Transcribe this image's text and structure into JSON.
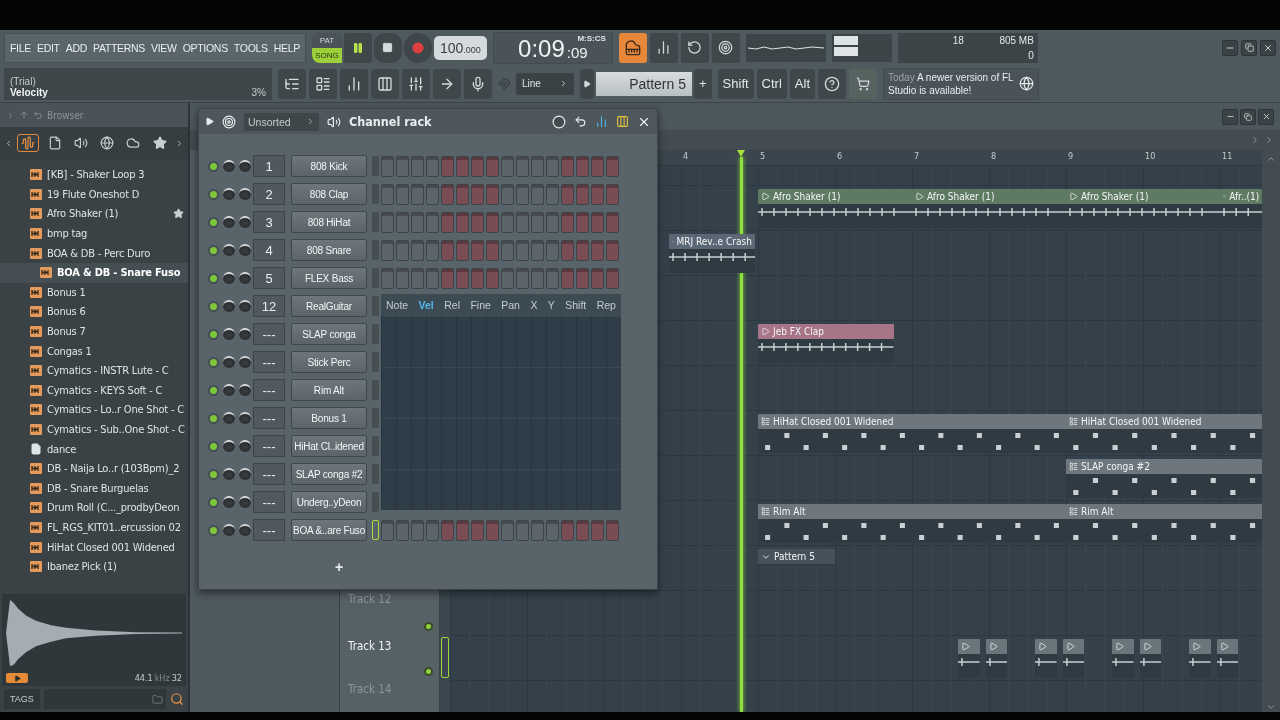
{
  "menu": [
    "FILE",
    "EDIT",
    "ADD",
    "PATTERNS",
    "VIEW",
    "OPTIONS",
    "TOOLS",
    "HELP"
  ],
  "transport": {
    "modes": [
      {
        "label": "PAT",
        "selected": false
      },
      {
        "label": "SONG",
        "selected": true
      }
    ],
    "tempo": "100",
    "tempo_fraction": ".000",
    "time": "0:09",
    "time_cs": ":09",
    "time_unit": "M:S:CS"
  },
  "hint": {
    "line1": "(Trial)",
    "line2": "Velocity",
    "value": "3%"
  },
  "snap": "Line",
  "pattern": "Pattern 5",
  "pattern_add": "+",
  "modifier_keys": [
    "Shift",
    "Ctrl",
    "Alt"
  ],
  "cpu": {
    "cpu_value": "18",
    "memory": "805 MB",
    "polyphony": "0"
  },
  "news": {
    "when": "Today",
    "text": "A newer version of FL Studio is available!"
  },
  "browser": {
    "title": "Browser",
    "items": [
      {
        "label": "[KB] - Shaker Loop 3",
        "kind": "audio",
        "selected": false,
        "starred": false
      },
      {
        "label": "19 Flute Oneshot D",
        "kind": "audio",
        "selected": false,
        "starred": false
      },
      {
        "label": "Afro Shaker (1)",
        "kind": "audio",
        "selected": false,
        "starred": true
      },
      {
        "label": "bmp tag",
        "kind": "audio",
        "selected": false,
        "starred": false
      },
      {
        "label": "BOA & DB - Perc Duro",
        "kind": "audio",
        "selected": false,
        "starred": false
      },
      {
        "label": "BOA & DB - Snare Fuso",
        "kind": "audio",
        "selected": true,
        "starred": false
      },
      {
        "label": "Bonus 1",
        "kind": "audio",
        "selected": false,
        "starred": false
      },
      {
        "label": "Bonus 6",
        "kind": "audio",
        "selected": false,
        "starred": false
      },
      {
        "label": "Bonus 7",
        "kind": "audio",
        "selected": false,
        "starred": false
      },
      {
        "label": "Congas 1",
        "kind": "audio",
        "selected": false,
        "starred": false
      },
      {
        "label": "Cymatics - INSTR Lute - C",
        "kind": "audio",
        "selected": false,
        "starred": false
      },
      {
        "label": "Cymatics - KEYS Soft - C",
        "kind": "audio",
        "selected": false,
        "starred": false
      },
      {
        "label": "Cymatics - Lo..r One Shot - C",
        "kind": "audio",
        "selected": false,
        "starred": false
      },
      {
        "label": "Cymatics - Sub..One Shot - C",
        "kind": "audio",
        "selected": false,
        "starred": false
      },
      {
        "label": "dance",
        "kind": "file",
        "selected": false,
        "starred": false
      },
      {
        "label": "DB - Naija Lo..r (103Bpm)_2",
        "kind": "audio",
        "selected": false,
        "starred": false
      },
      {
        "label": "DB - Snare Burguelas",
        "kind": "audio",
        "selected": false,
        "starred": false
      },
      {
        "label": "Drum Roll (C..._prodbyDeon",
        "kind": "audio",
        "selected": false,
        "starred": false
      },
      {
        "label": "FL_RGS_KIT01..ercussion 02",
        "kind": "audio",
        "selected": false,
        "starred": false
      },
      {
        "label": "HiHat Closed 001 Widened",
        "kind": "audio",
        "selected": false,
        "starred": false
      },
      {
        "label": "Ibanez Pick (1)",
        "kind": "audio",
        "selected": false,
        "starred": false
      }
    ],
    "sample_info": {
      "rate": "44.1",
      "unit": "kHz",
      "bits": "32"
    },
    "tags_button": "TAGS"
  },
  "channel_rack": {
    "title": "Channel rack",
    "filter": "Unsorted",
    "add": "+",
    "channels": [
      {
        "track": "1",
        "name": "808 Kick",
        "enabled": true,
        "selected": false
      },
      {
        "track": "2",
        "name": "808 Clap",
        "enabled": true,
        "selected": false
      },
      {
        "track": "3",
        "name": "808 HiHat",
        "enabled": true,
        "selected": false
      },
      {
        "track": "4",
        "name": "808 Snare",
        "enabled": true,
        "selected": false
      },
      {
        "track": "5",
        "name": "FLEX Bass",
        "enabled": true,
        "selected": false
      },
      {
        "track": "12",
        "name": "RealGuitar",
        "enabled": true,
        "selected": false
      },
      {
        "track": "---",
        "name": "SLAP conga",
        "enabled": true,
        "selected": false
      },
      {
        "track": "---",
        "name": "Stick Perc",
        "enabled": true,
        "selected": false
      },
      {
        "track": "---",
        "name": "Rim  Alt",
        "enabled": true,
        "selected": false
      },
      {
        "track": "---",
        "name": "Bonus 1",
        "enabled": true,
        "selected": false
      },
      {
        "track": "---",
        "name": "HiHat Cl..idened",
        "enabled": true,
        "selected": false
      },
      {
        "track": "---",
        "name": "SLAP conga #2",
        "enabled": true,
        "selected": false
      },
      {
        "track": "---",
        "name": "Underg..yDeon",
        "enabled": true,
        "selected": false
      },
      {
        "track": "---",
        "name": "BOA &..are Fuso",
        "enabled": true,
        "selected": true
      }
    ],
    "graph_editor": {
      "tabs": [
        {
          "label": "Note",
          "selected": false
        },
        {
          "label": "Vel",
          "selected": true
        },
        {
          "label": "Rel",
          "selected": false
        },
        {
          "label": "Fine",
          "selected": false
        },
        {
          "label": "Pan",
          "selected": false
        },
        {
          "label": "X",
          "selected": false
        },
        {
          "label": "Y",
          "selected": false
        },
        {
          "label": "Shift",
          "selected": false
        },
        {
          "label": "Rep",
          "selected": false
        }
      ]
    }
  },
  "playlist": {
    "ruler": [
      "4",
      "5",
      "6",
      "7",
      "8",
      "9",
      "10",
      "11"
    ],
    "tracks": [
      {
        "kind": "lane",
        "clips": [
          {
            "label": "Afro Shaker (1)",
            "kind": "audio",
            "color": "#5f7a63"
          },
          {
            "label": "Afro Shaker (1)",
            "kind": "audio",
            "color": "#5f7a63"
          },
          {
            "label": "Afro Shaker (1)",
            "kind": "audio",
            "color": "#5f7a63"
          },
          {
            "label": "Afr..(1)",
            "kind": "audio",
            "color": "#5f7a63"
          }
        ]
      },
      {
        "kind": "lane",
        "clips": [
          {
            "label": "MRJ Rev..e Crash",
            "kind": "audio",
            "color": "#5c6775"
          }
        ]
      },
      {
        "kind": "lane"
      },
      {
        "kind": "lane",
        "clips": [
          {
            "label": "Jeb FX Clap",
            "kind": "audio",
            "color": "#a77488"
          }
        ]
      },
      {
        "kind": "lane"
      },
      {
        "kind": "lane",
        "clips": [
          {
            "label": "HiHat Closed 001 Widened",
            "kind": "pattern",
            "color": "#6d777d"
          },
          {
            "label": "HiHat Closed 001 Widened",
            "kind": "pattern",
            "color": "#6d777d"
          }
        ]
      },
      {
        "kind": "lane",
        "clips": [
          {
            "label": "SLAP conga #2",
            "kind": "pattern",
            "color": "#6d777d"
          }
        ]
      },
      {
        "kind": "lane",
        "clips": [
          {
            "label": "Rim  Alt",
            "kind": "pattern",
            "color": "#6d777d"
          },
          {
            "label": "Rim  Alt",
            "kind": "pattern",
            "color": "#6d777d"
          }
        ]
      },
      {
        "kind": "lane",
        "clips": [
          {
            "label": "Pattern 5",
            "kind": "folded",
            "color": "#46525b"
          }
        ]
      },
      {
        "kind": "lane",
        "name": "Track 12",
        "selected": false
      },
      {
        "kind": "lane",
        "name": "Track 13",
        "selected": true,
        "clips": [
          {
            "kind": "audio",
            "color": "#6a757c"
          },
          {
            "kind": "audio",
            "color": "#6a757c"
          },
          {
            "kind": "audio",
            "color": "#6a757c"
          },
          {
            "kind": "audio",
            "color": "#6a757c"
          },
          {
            "kind": "audio",
            "color": "#6a757c"
          },
          {
            "kind": "audio",
            "color": "#6a757c"
          },
          {
            "kind": "audio",
            "color": "#6a757c"
          },
          {
            "kind": "audio",
            "color": "#6a757c"
          }
        ]
      },
      {
        "kind": "lane",
        "name": "Track 14",
        "selected": false
      }
    ]
  }
}
